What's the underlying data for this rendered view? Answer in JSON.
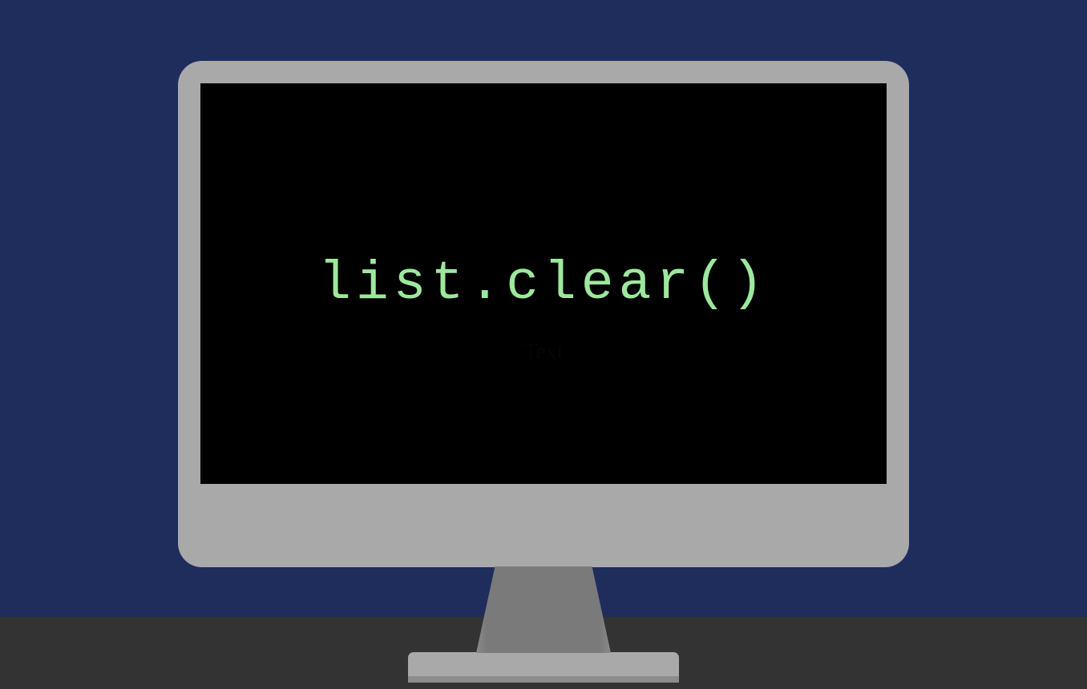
{
  "screen": {
    "code": "list.clear()",
    "placeholder": "Text"
  }
}
